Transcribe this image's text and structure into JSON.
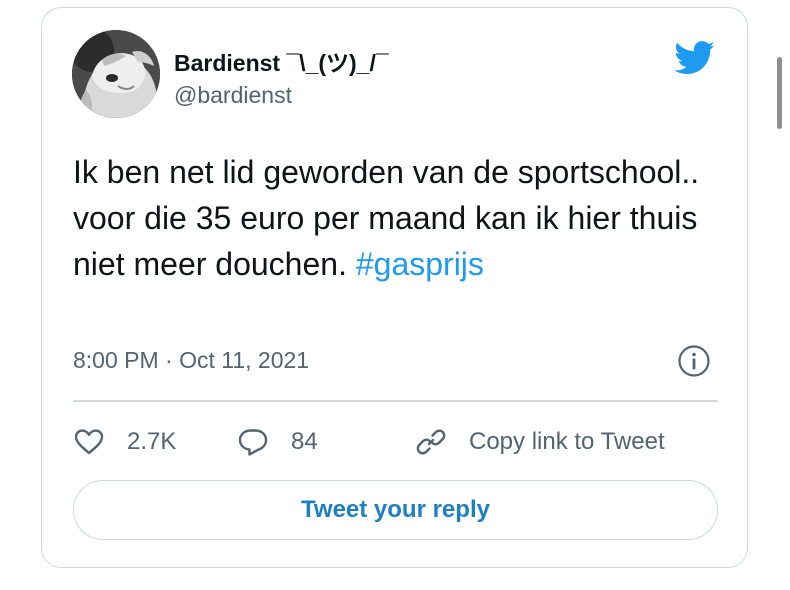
{
  "author": {
    "display_name": "Bardienst ¯\\_(ツ)_/¯",
    "handle": "@bardienst",
    "avatar_icon": "dog-avatar"
  },
  "brand": {
    "icon": "twitter-bird-icon",
    "color": "#1d9bf0"
  },
  "tweet": {
    "text": "Ik ben net lid geworden van de sportschool.. voor die 35 euro per maand kan ik hier thuis niet meer douchen. ",
    "hashtag": "#gasprijs",
    "timestamp": "8:00 PM · Oct 11, 2021"
  },
  "actions": {
    "likes": "2.7K",
    "replies": "84",
    "copy_link_label": "Copy link to Tweet"
  },
  "reply": {
    "label": "Tweet your reply"
  }
}
